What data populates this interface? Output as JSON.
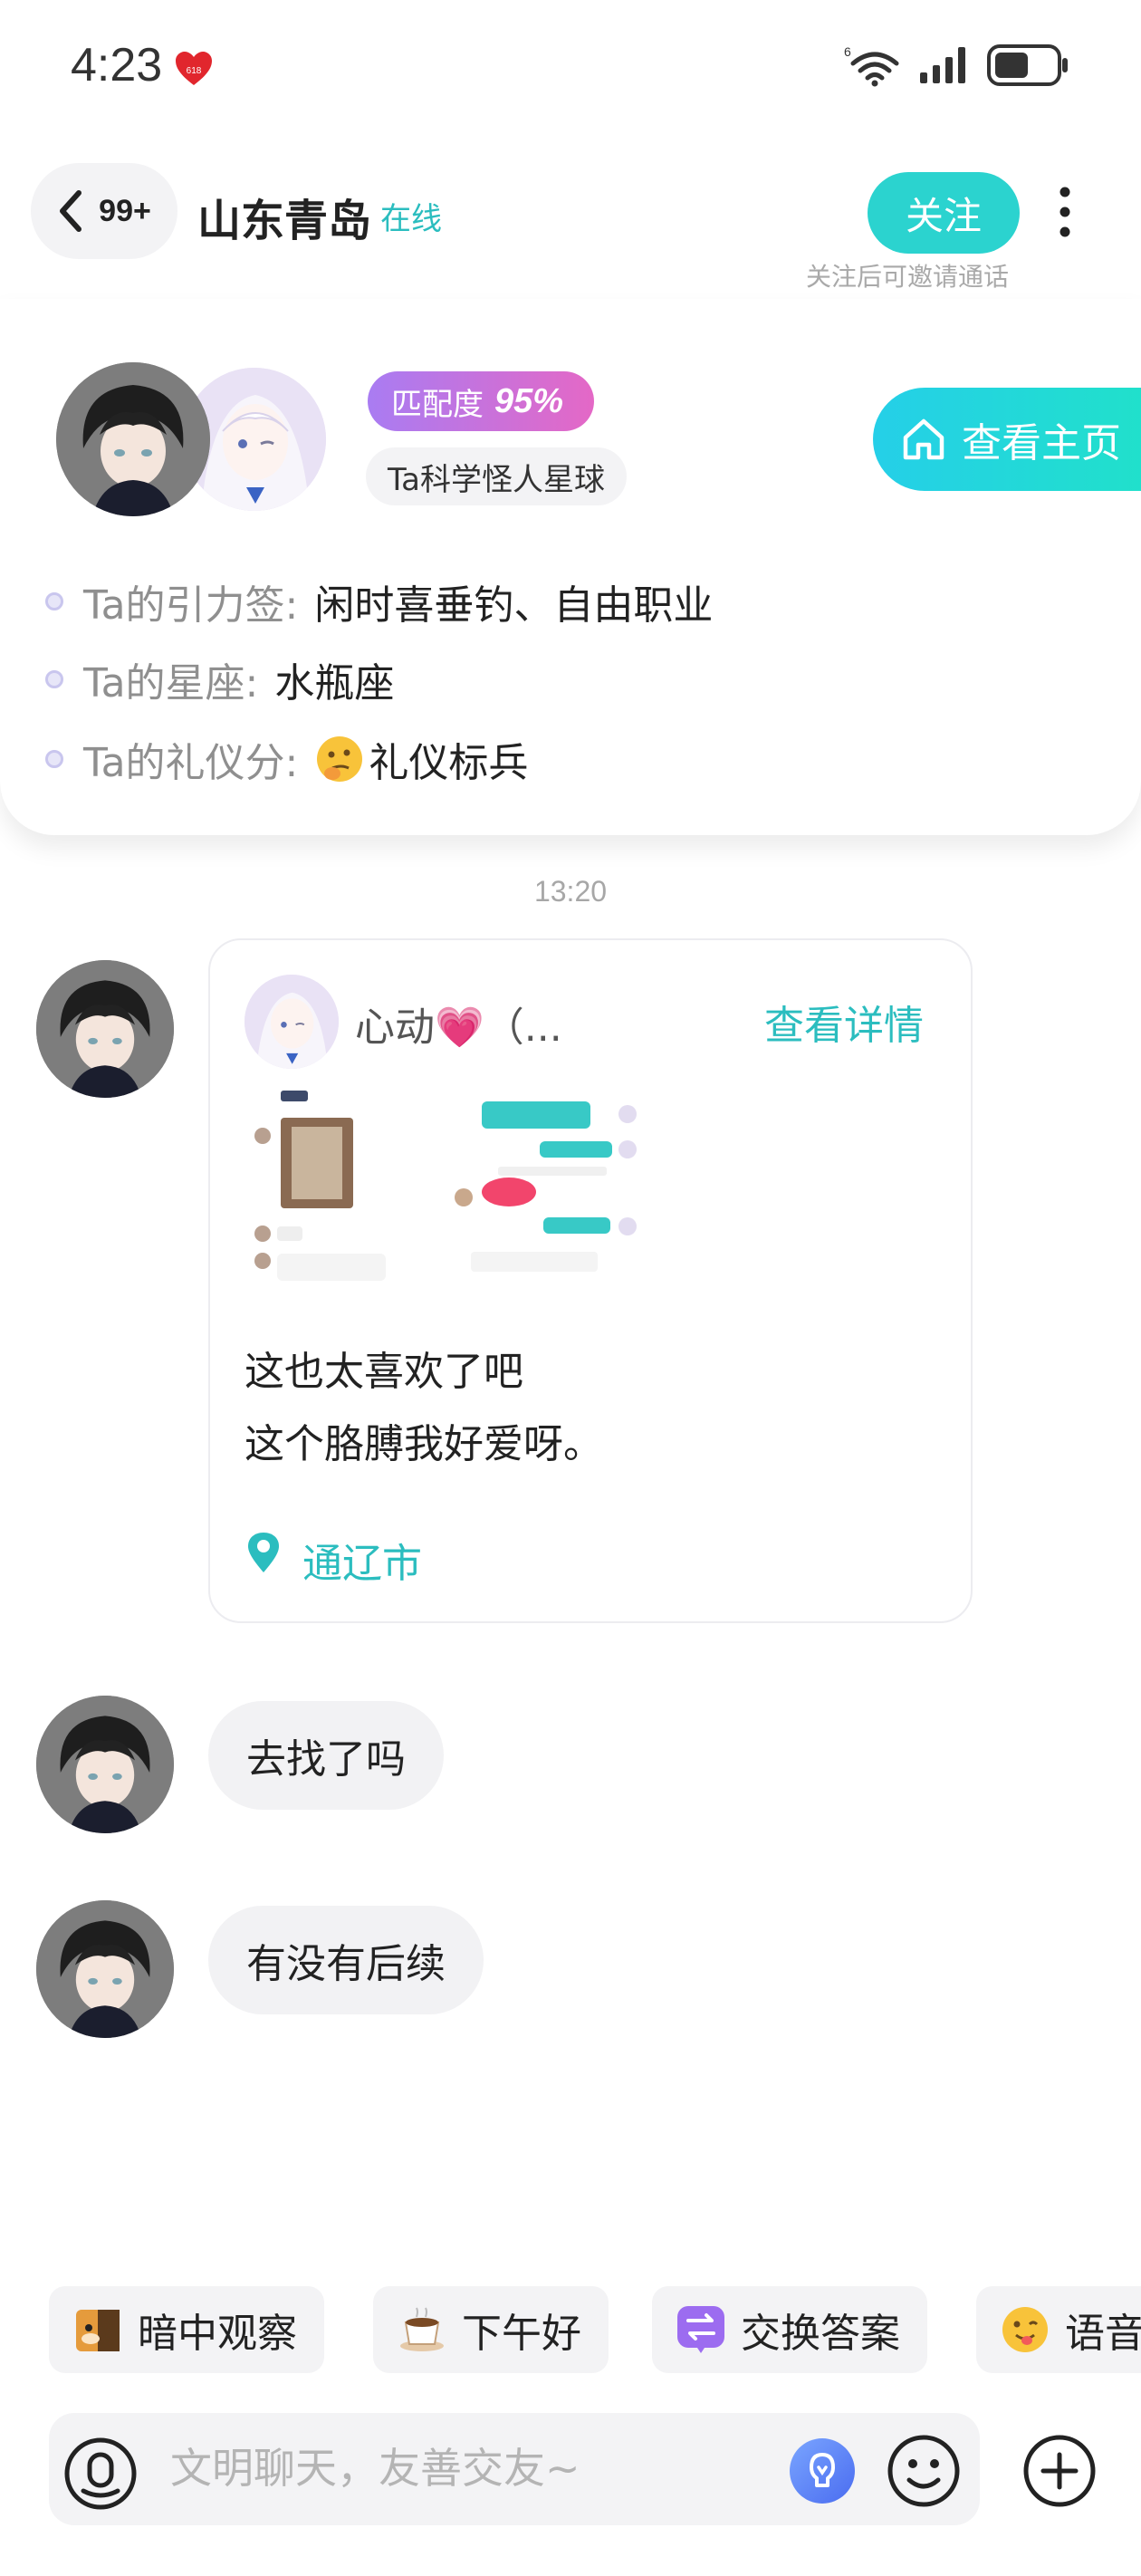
{
  "status_bar": {
    "time": "4:23",
    "notify_badge": "618",
    "network_label": "6"
  },
  "header": {
    "back_count": "99+",
    "title": "山东青岛",
    "online_status": "在线",
    "follow_label": "关注",
    "follow_hint": "关注后可邀请通话"
  },
  "profile": {
    "match_label": "匹配度",
    "match_value": "95%",
    "planet_tag": "Ta科学怪人星球",
    "homepage_label": "查看主页",
    "info": [
      {
        "label": "Ta的引力签:",
        "value": "闲时喜垂钓、自由职业"
      },
      {
        "label": "Ta的星座:",
        "value": "水瓶座"
      },
      {
        "label": "Ta的礼仪分:",
        "value": "礼仪标兵"
      }
    ]
  },
  "chat": {
    "timestamp": "13:20",
    "share_card": {
      "name": "心动💗（...",
      "detail_label": "查看详情",
      "line1": "这也太喜欢了吧",
      "line2": "这个胳膊我好爱呀。",
      "location": "通辽市"
    },
    "messages": [
      {
        "text": "去找了吗"
      },
      {
        "text": "有没有后续"
      }
    ]
  },
  "quick_replies": [
    {
      "label": "暗中观察",
      "icon": "shiba-dog-icon"
    },
    {
      "label": "下午好",
      "icon": "coffee-cup-icon"
    },
    {
      "label": "交换答案",
      "icon": "swap-arrows-icon"
    },
    {
      "label": "语音",
      "icon": "emoji-tongue-icon"
    }
  ],
  "input": {
    "placeholder": "文明聊天，友善交友~"
  },
  "colors": {
    "accent": "#2bd3cf",
    "link": "#2bbdbf",
    "match_gradient_start": "#a97cf2",
    "match_gradient_end": "#e468c6"
  }
}
